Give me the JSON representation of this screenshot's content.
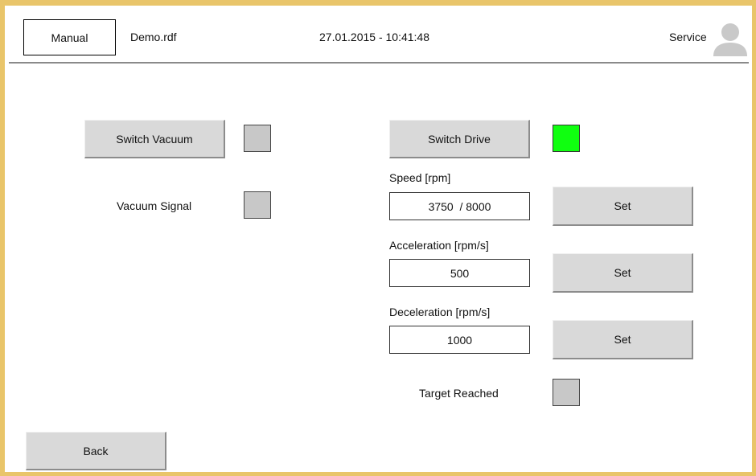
{
  "header": {
    "mode": "Manual",
    "file": "Demo.rdf",
    "datetime": "27.01.2015 - 10:41:48",
    "user_role": "Service",
    "avatar_icon": "user-avatar-icon"
  },
  "vacuum": {
    "switch_label": "Switch Vacuum",
    "switch_state": "off",
    "signal_label": "Vacuum Signal",
    "signal_state": "off"
  },
  "drive": {
    "switch_label": "Switch Drive",
    "switch_state": "on",
    "speed": {
      "label": "Speed [rpm]",
      "value": "3750  / 8000",
      "set_label": "Set"
    },
    "acceleration": {
      "label": "Acceleration [rpm/s]",
      "value": "500",
      "set_label": "Set"
    },
    "deceleration": {
      "label": "Deceleration [rpm/s]",
      "value": "1000",
      "set_label": "Set"
    },
    "target_label": "Target Reached",
    "target_state": "off"
  },
  "footer": {
    "back_label": "Back"
  },
  "colors": {
    "indicator_on": "#10ff10",
    "indicator_off": "#c8c8c8",
    "frame": "#e9c56a",
    "button": "#d9d9d9"
  }
}
